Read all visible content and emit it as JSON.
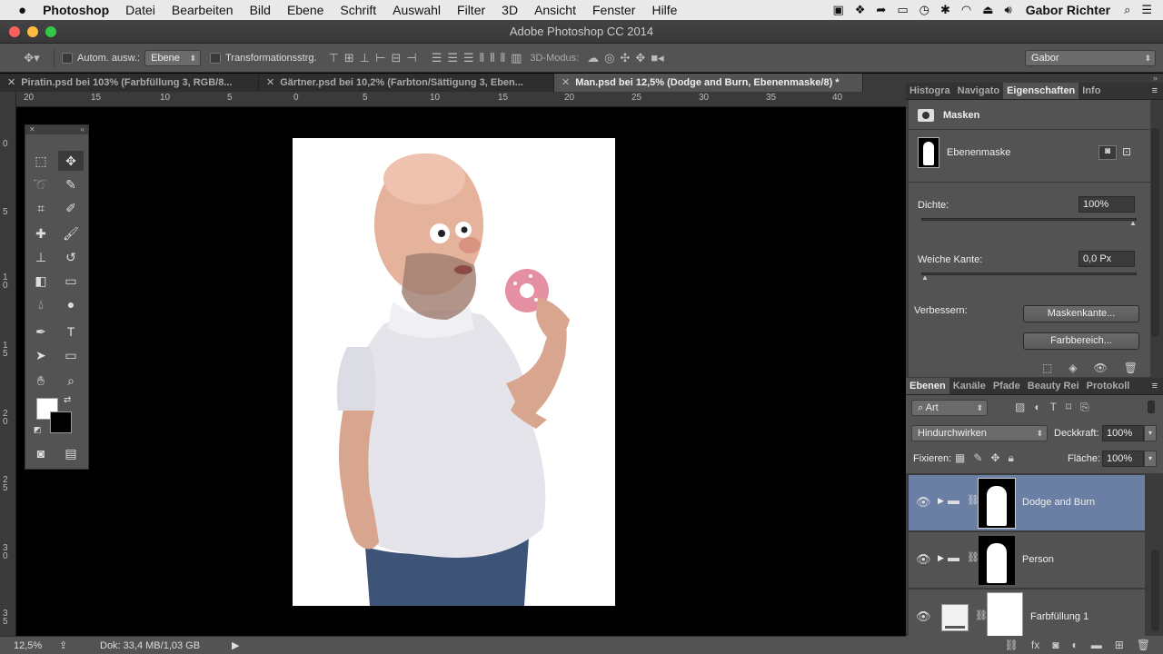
{
  "menubar": {
    "apple": "",
    "app": "Photoshop",
    "items": [
      "Datei",
      "Bearbeiten",
      "Bild",
      "Ebene",
      "Schrift",
      "Auswahl",
      "Filter",
      "3D",
      "Ansicht",
      "Fenster",
      "Hilfe"
    ],
    "user": "Gabor Richter"
  },
  "window": {
    "title": "Adobe Photoshop CC 2014"
  },
  "options": {
    "auto_select_label": "Autom. ausw.:",
    "auto_select_value": "Ebene",
    "transform_label": "Transformationsstrg.",
    "mode3d_label": "3D-Modus:",
    "workspace": "Gabor"
  },
  "tabs": [
    {
      "label": "Piratin.psd bei 103% (Farbfüllung 3, RGB/8..."
    },
    {
      "label": "Gärtner.psd bei 10,2% (Farbton/Sättigung 3, Eben..."
    },
    {
      "label": "Man.psd bei 12,5% (Dodge and Burn, Ebenenmaske/8) *"
    }
  ],
  "ruler": {
    "h": [
      "20",
      "15",
      "10",
      "5",
      "0",
      "5",
      "10",
      "15",
      "20",
      "25",
      "30",
      "35",
      "40"
    ],
    "v": [
      "0",
      "5",
      "1\n0",
      "1\n5",
      "2\n0",
      "2\n5",
      "3\n0",
      "3\n5"
    ]
  },
  "status": {
    "zoom": "12,5%",
    "doc": "Dok: 33,4 MB/1,03 GB"
  },
  "properties": {
    "tabs": [
      "Histogra",
      "Navigato",
      "Eigenschaften",
      "Info"
    ],
    "section": "Masken",
    "mask_label": "Ebenenmaske",
    "density_label": "Dichte:",
    "density_value": "100%",
    "density": 1.0,
    "feather_label": "Weiche Kante:",
    "feather_value": "0,0 Px",
    "feather": 0.0,
    "refine_label": "Verbessern:",
    "mask_edge_button": "Maskenkante...",
    "color_range_button": "Farbbereich..."
  },
  "layers_panel": {
    "tabs": [
      "Ebenen",
      "Kanäle",
      "Pfade",
      "Beauty Rei",
      "Protokoll"
    ],
    "filter": "Art",
    "blend_mode": "Hindurchwirken",
    "opacity_label": "Deckkraft:",
    "opacity_value": "100%",
    "lock_label": "Fixieren:",
    "fill_label": "Fläche:",
    "fill_value": "100%",
    "layers": [
      {
        "name": "Dodge and Burn"
      },
      {
        "name": "Person"
      },
      {
        "name": "Farbfüllung 1"
      }
    ]
  },
  "colors": {
    "accent_selected_layer": "#6a7fa3",
    "panel": "#535353",
    "dark": "#3b3b3b"
  }
}
